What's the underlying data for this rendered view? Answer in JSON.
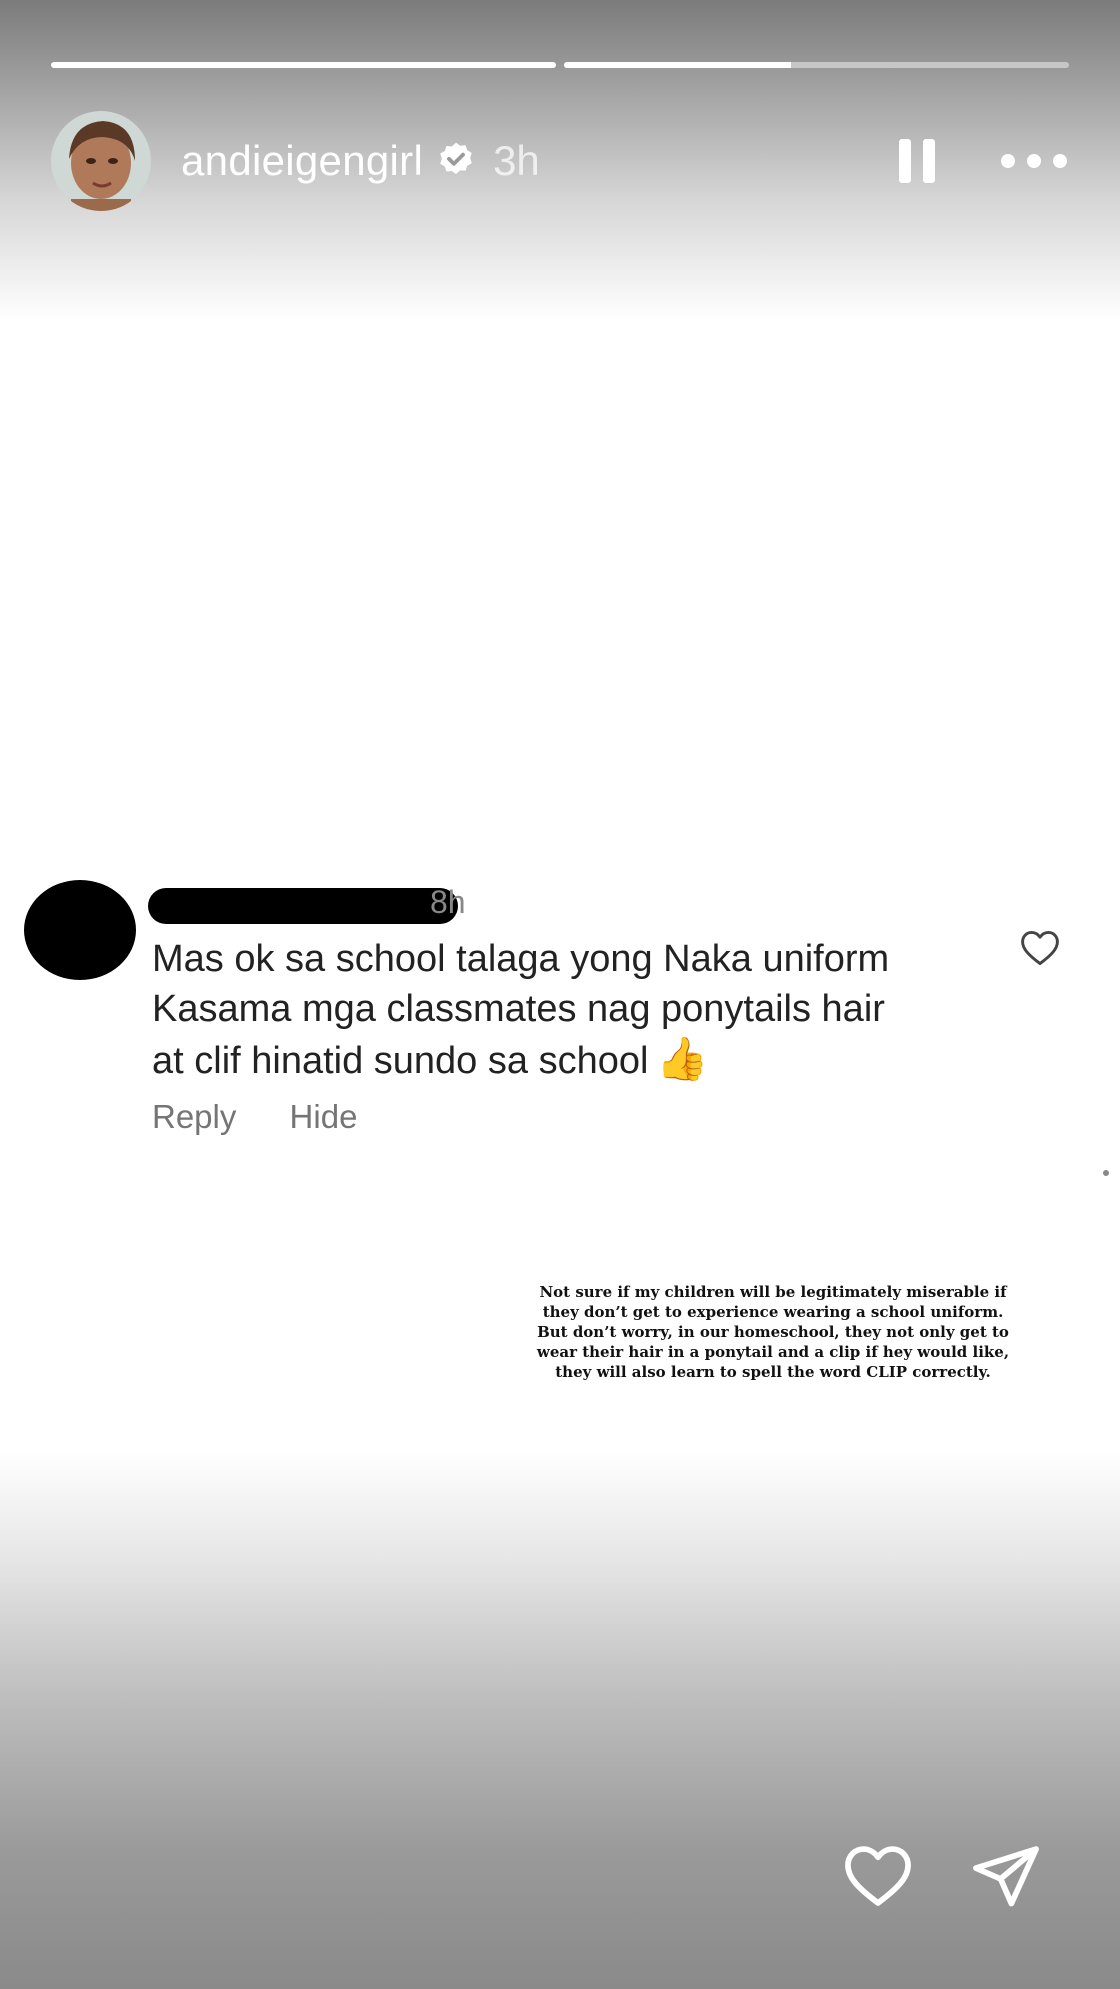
{
  "progress": [
    1.0,
    0.45
  ],
  "header": {
    "username": "andieigengirl",
    "time": "3h",
    "verified_icon": "verified-badge-icon",
    "pause_icon": "pause-icon",
    "more_icon": "more-options-icon"
  },
  "comment": {
    "time": "8h",
    "lines": [
      "Mas ok sa school talaga yong Naka uniform",
      "Kasama mga classmates nag ponytails hair",
      "at clif hinatid sundo sa school"
    ],
    "emoji": "👍",
    "reply_label": "Reply",
    "hide_label": "Hide",
    "like_icon": "heart-outline-icon"
  },
  "note": {
    "lines": [
      "Not sure if my children will be legitimately miserable if",
      "they don’t get to experience wearing a school uniform.",
      "But don’t worry, in our homeschool, they not only get to",
      "wear their hair in a ponytail and a clip if hey would like,",
      "they will also learn to spell the word CLIP correctly."
    ]
  },
  "footer": {
    "like_icon": "heart-icon",
    "send_icon": "send-icon"
  }
}
